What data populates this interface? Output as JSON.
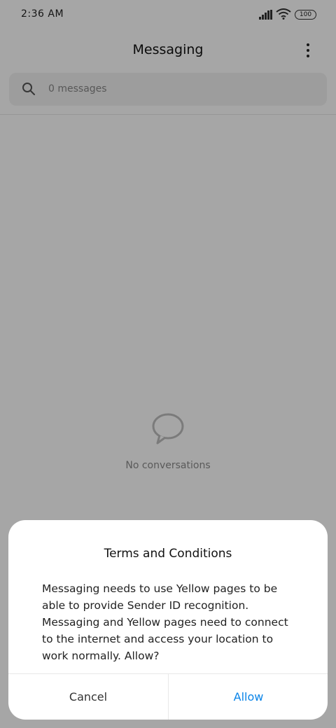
{
  "status_bar": {
    "time": "2:36 AM",
    "battery": "100",
    "icons": [
      "signal-icon",
      "wifi-icon",
      "battery-icon"
    ]
  },
  "header": {
    "title": "Messaging",
    "menu_icon": "more-vertical-icon"
  },
  "search": {
    "placeholder": "0 messages",
    "icon": "search-icon"
  },
  "empty_state": {
    "icon": "chat-bubble-icon",
    "text": "No conversations"
  },
  "dialog": {
    "title": "Terms and Conditions",
    "message": "Messaging needs to use Yellow pages to be able to provide Sender ID recognition. Messaging and Yellow pages need to connect to the internet and access your location to work normally. Allow?",
    "cancel_label": "Cancel",
    "allow_label": "Allow"
  },
  "colors": {
    "accent": "#0a84e8",
    "scrim": "rgba(0,0,0,0.35)"
  }
}
